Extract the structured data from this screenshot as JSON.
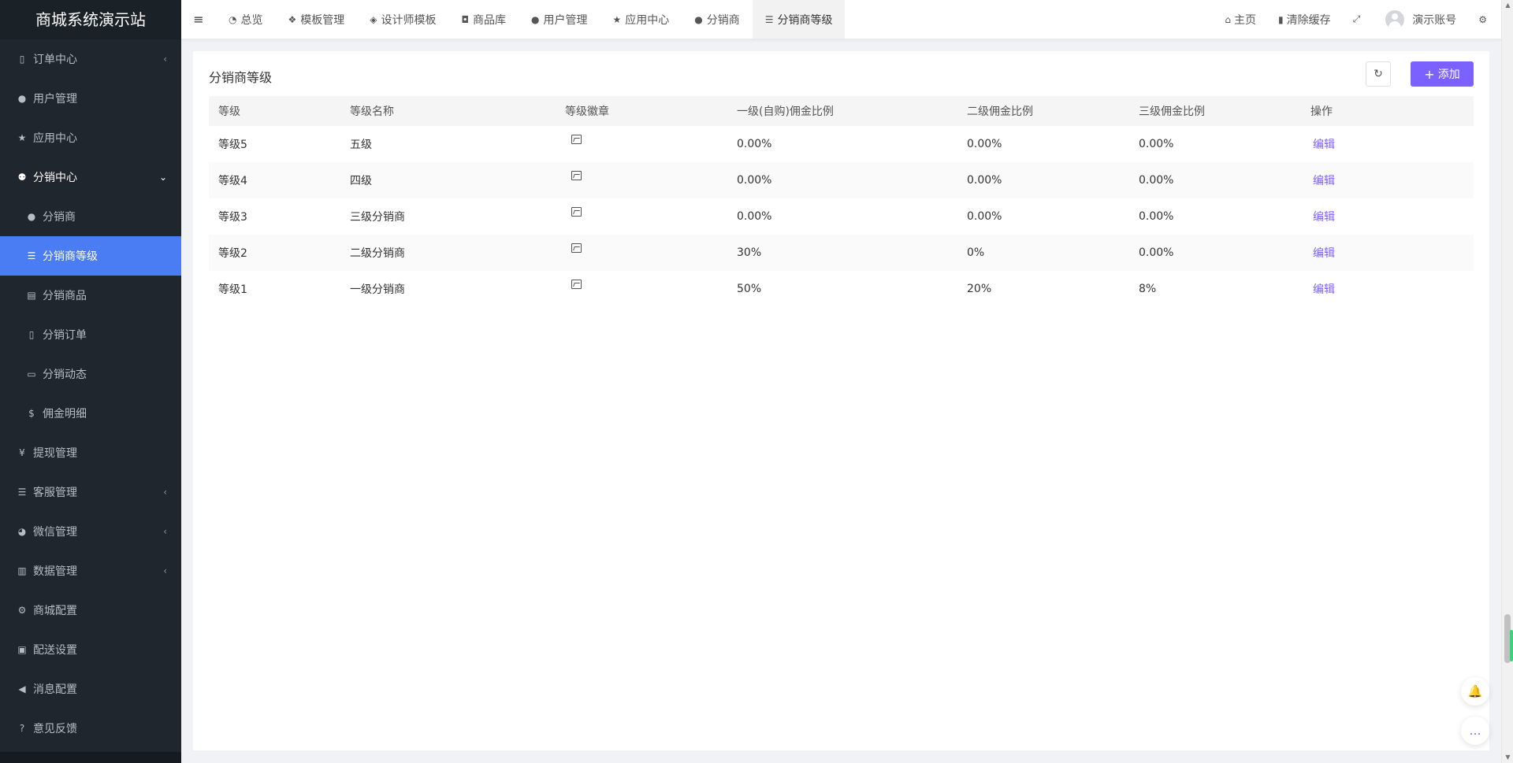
{
  "app": {
    "title": "商城系统演示站"
  },
  "sidebar": {
    "items": [
      {
        "label": "订单中心",
        "icon": "file-icon",
        "glyph": "▯",
        "arrow": "‹"
      },
      {
        "label": "用户管理",
        "icon": "user-icon",
        "glyph": "●"
      },
      {
        "label": "应用中心",
        "icon": "star-icon",
        "glyph": "★"
      },
      {
        "label": "分销中心",
        "icon": "users-icon",
        "glyph": "⚉",
        "arrow": "⌄"
      },
      {
        "label": "分销商",
        "icon": "user-icon",
        "glyph": "●"
      },
      {
        "label": "分销商等级",
        "icon": "list-icon",
        "glyph": "☰"
      },
      {
        "label": "分销商品",
        "icon": "briefcase-icon",
        "glyph": "▤"
      },
      {
        "label": "分销订单",
        "icon": "file-icon",
        "glyph": "▯"
      },
      {
        "label": "分销动态",
        "icon": "id-card-icon",
        "glyph": "▭"
      },
      {
        "label": "佣金明细",
        "icon": "dollar-icon",
        "glyph": "$"
      },
      {
        "label": "提现管理",
        "icon": "yen-icon",
        "glyph": "¥"
      },
      {
        "label": "客服管理",
        "icon": "list-icon",
        "glyph": "☰",
        "arrow": "‹"
      },
      {
        "label": "微信管理",
        "icon": "wechat-icon",
        "glyph": "◕",
        "arrow": "‹"
      },
      {
        "label": "数据管理",
        "icon": "bar-chart-icon",
        "glyph": "▥",
        "arrow": "‹"
      },
      {
        "label": "商城配置",
        "icon": "gears-icon",
        "glyph": "⚙"
      },
      {
        "label": "配送设置",
        "icon": "car-icon",
        "glyph": "▣"
      },
      {
        "label": "消息配置",
        "icon": "bullhorn-icon",
        "glyph": "◀"
      },
      {
        "label": "意见反馈",
        "icon": "question-icon",
        "glyph": "?"
      }
    ]
  },
  "header": {
    "menu_glyph": "≡",
    "tabs": [
      {
        "label": "总览",
        "icon": "pie-chart-icon",
        "glyph": "◔"
      },
      {
        "label": "模板管理",
        "icon": "cubes-icon",
        "glyph": "❖"
      },
      {
        "label": "设计师模板",
        "icon": "cube-icon",
        "glyph": "◈"
      },
      {
        "label": "商品库",
        "icon": "shopping-bag-icon",
        "glyph": "◘"
      },
      {
        "label": "用户管理",
        "icon": "user-icon",
        "glyph": "●"
      },
      {
        "label": "应用中心",
        "icon": "star-icon",
        "glyph": "★"
      },
      {
        "label": "分销商",
        "icon": "user-icon",
        "glyph": "●"
      },
      {
        "label": "分销商等级",
        "icon": "list-icon",
        "glyph": "☰"
      }
    ],
    "home_label": "主页",
    "home_glyph": "⌂",
    "clear_cache_label": "清除缓存",
    "clear_cache_glyph": "▮",
    "fullscreen_glyph": "⤢",
    "account_label": "演示账号",
    "settings_glyph": "⚙"
  },
  "page": {
    "title": "分销商等级",
    "refresh_glyph": "↻",
    "add_plus": "+",
    "add_label": "添加"
  },
  "table": {
    "columns": [
      "等级",
      "等级名称",
      "等级徽章",
      "一级(自购)佣金比例",
      "二级佣金比例",
      "三级佣金比例",
      "操作"
    ],
    "rows": [
      {
        "level": "等级5",
        "name": "五级",
        "first": "0.00%",
        "second": "0.00%",
        "third": "0.00%",
        "action": "编辑"
      },
      {
        "level": "等级4",
        "name": "四级",
        "first": "0.00%",
        "second": "0.00%",
        "third": "0.00%",
        "action": "编辑"
      },
      {
        "level": "等级3",
        "name": "三级分销商",
        "first": "0.00%",
        "second": "0.00%",
        "third": "0.00%",
        "action": "编辑"
      },
      {
        "level": "等级2",
        "name": "二级分销商",
        "first": "30%",
        "second": "0%",
        "third": "0.00%",
        "action": "编辑"
      },
      {
        "level": "等级1",
        "name": "一级分销商",
        "first": "50%",
        "second": "20%",
        "third": "8%",
        "action": "编辑"
      }
    ]
  },
  "float": {
    "bell_glyph": "🔔",
    "chat_glyph": "…"
  },
  "colors": {
    "sidebar_bg": "#1f262d",
    "active": "#4a7cf3",
    "accent": "#7b61ff"
  }
}
